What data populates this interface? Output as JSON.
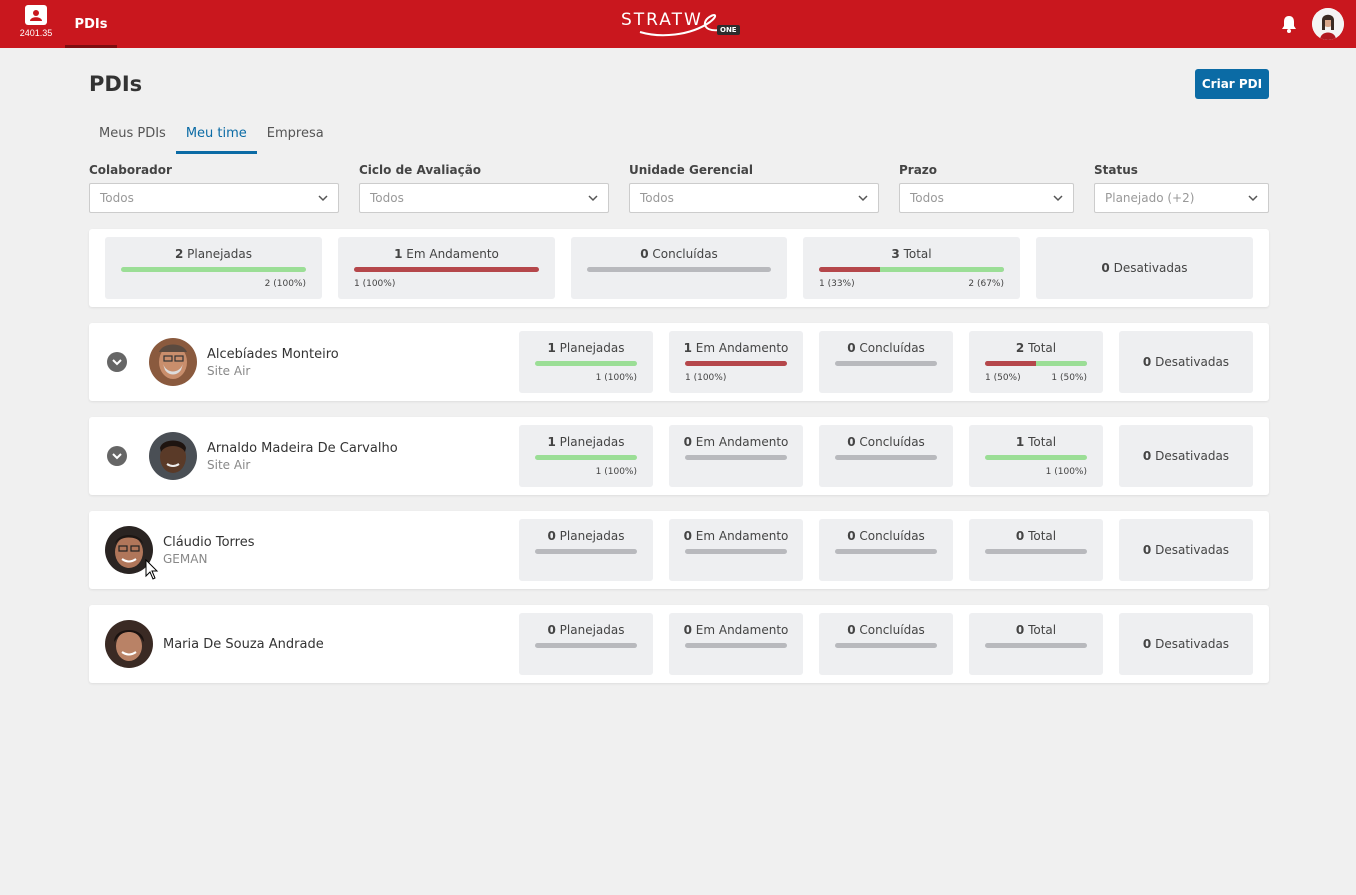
{
  "topbar": {
    "app_code": "2401.35",
    "tab_label": "PDIs",
    "logo_text": "STRATW",
    "logo_badge": "ONE"
  },
  "header": {
    "title": "PDIs",
    "create_label": "Criar PDI"
  },
  "tabs": [
    {
      "label": "Meus PDIs",
      "active": false
    },
    {
      "label": "Meu time",
      "active": true
    },
    {
      "label": "Empresa",
      "active": false
    }
  ],
  "filters": [
    {
      "label": "Colaborador",
      "value": "Todos"
    },
    {
      "label": "Ciclo de Avaliação",
      "value": "Todos"
    },
    {
      "label": "Unidade Gerencial",
      "value": "Todos"
    },
    {
      "label": "Prazo",
      "value": "Todos"
    },
    {
      "label": "Status",
      "value": "Planejado (+2)"
    }
  ],
  "summary": {
    "planned": {
      "count": "2",
      "label": "Planejadas",
      "pct": "2 (100%)"
    },
    "in_progress": {
      "count": "1",
      "label": "Em Andamento",
      "pct": "1 (100%)"
    },
    "completed": {
      "count": "0",
      "label": "Concluídas"
    },
    "total": {
      "count": "3",
      "label": "Total",
      "pct_left": "1 (33%)",
      "pct_right": "2 (67%)"
    },
    "disabled": {
      "count": "0",
      "label": "Desativadas"
    }
  },
  "people": [
    {
      "name": "Alcebíades Monteiro",
      "unit": "Site Air",
      "planned": {
        "count": "1",
        "label": "Planejadas",
        "pct": "1 (100%)"
      },
      "in_progress": {
        "count": "1",
        "label": "Em Andamento",
        "pct": "1 (100%)"
      },
      "completed": {
        "count": "0",
        "label": "Concluídas"
      },
      "total": {
        "count": "2",
        "label": "Total",
        "pct_left": "1 (50%)",
        "pct_right": "1 (50%)"
      },
      "disabled": {
        "count": "0",
        "label": "Desativadas"
      }
    },
    {
      "name": "Arnaldo Madeira De Carvalho",
      "unit": "Site Air",
      "planned": {
        "count": "1",
        "label": "Planejadas",
        "pct": "1 (100%)"
      },
      "in_progress": {
        "count": "0",
        "label": "Em Andamento"
      },
      "completed": {
        "count": "0",
        "label": "Concluídas"
      },
      "total": {
        "count": "1",
        "label": "Total",
        "pct": "1 (100%)"
      },
      "disabled": {
        "count": "0",
        "label": "Desativadas"
      }
    },
    {
      "name": "Cláudio Torres",
      "unit": "GEMAN",
      "planned": {
        "count": "0",
        "label": "Planejadas"
      },
      "in_progress": {
        "count": "0",
        "label": "Em Andamento"
      },
      "completed": {
        "count": "0",
        "label": "Concluídas"
      },
      "total": {
        "count": "0",
        "label": "Total"
      },
      "disabled": {
        "count": "0",
        "label": "Desativadas"
      }
    },
    {
      "name": "Maria De Souza Andrade",
      "planned": {
        "count": "0",
        "label": "Planejadas"
      },
      "in_progress": {
        "count": "0",
        "label": "Em Andamento"
      },
      "completed": {
        "count": "0",
        "label": "Concluídas"
      },
      "total": {
        "count": "0",
        "label": "Total"
      },
      "disabled": {
        "count": "0",
        "label": "Desativadas"
      }
    }
  ],
  "colors": {
    "brand_red": "#c9171e",
    "primary_blue": "#0b6ba5",
    "bar_green": "#9bde96",
    "bar_red": "#b5474b",
    "bar_empty": "#b8b9bd"
  }
}
